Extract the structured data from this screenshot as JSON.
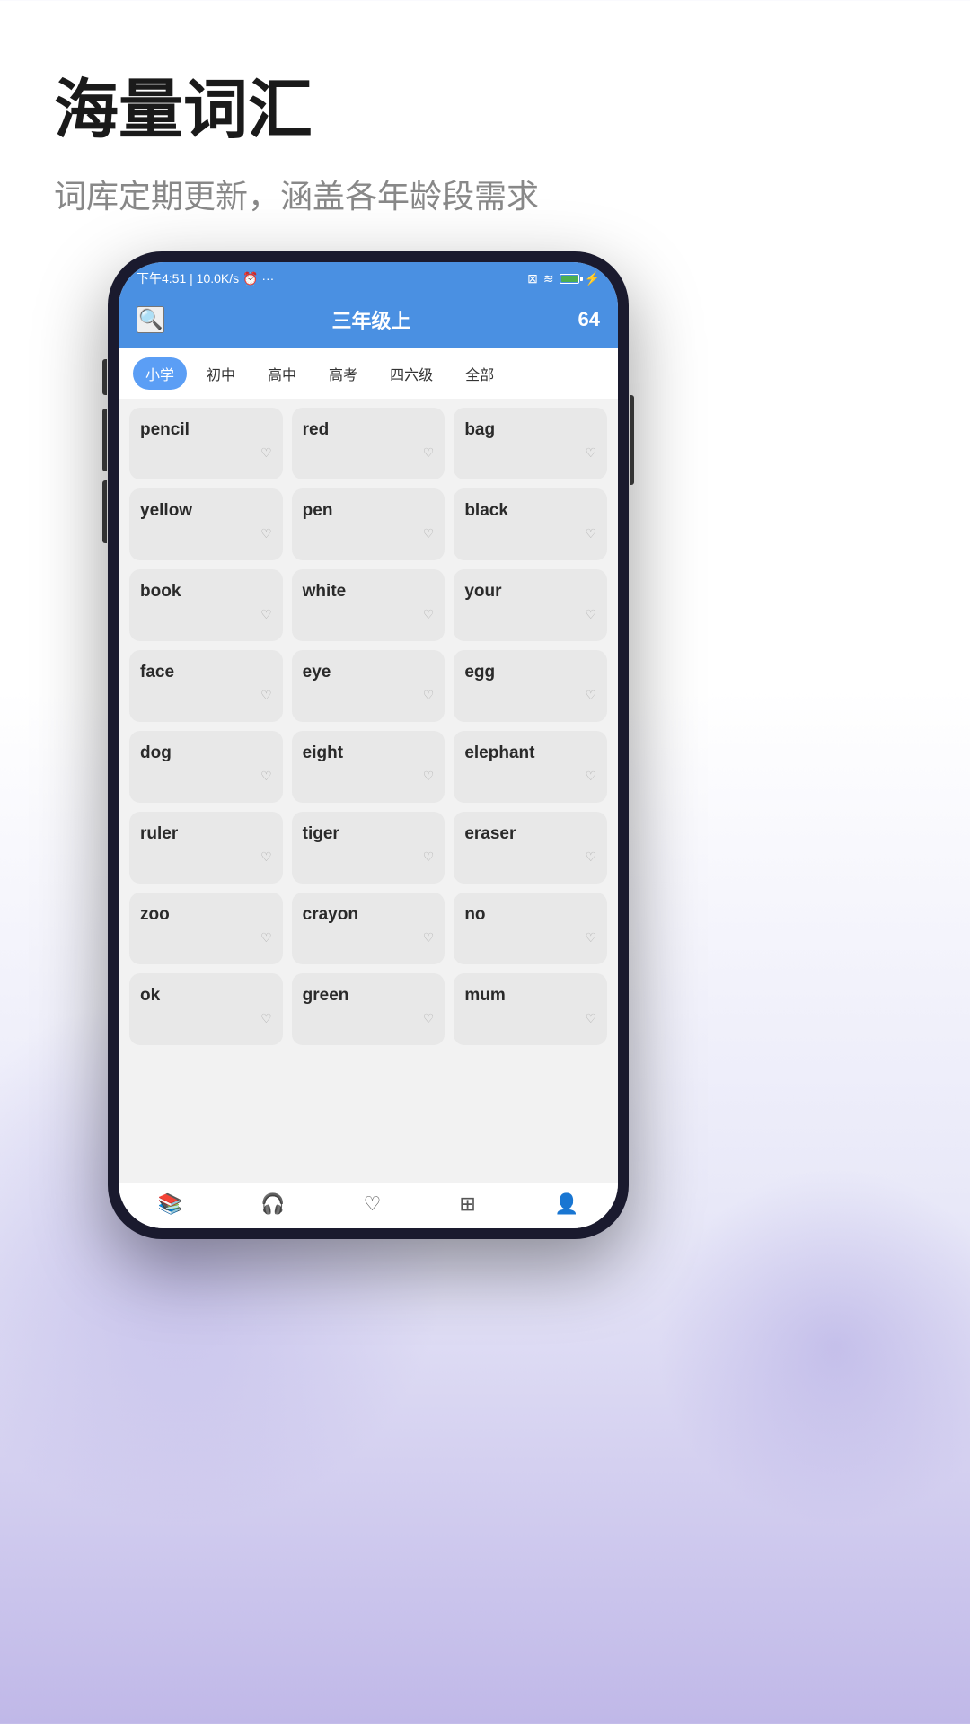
{
  "page": {
    "title": "海量词汇",
    "subtitle": "词库定期更新，涵盖各年龄段需求"
  },
  "status_bar": {
    "time": "下午4:51",
    "network": "10.0K/s",
    "icons": "⊠ ☁ 100"
  },
  "app_header": {
    "title": "三年级上",
    "word_count": "64"
  },
  "tabs": [
    {
      "label": "小学",
      "active": true
    },
    {
      "label": "初中",
      "active": false
    },
    {
      "label": "高中",
      "active": false
    },
    {
      "label": "高考",
      "active": false
    },
    {
      "label": "四六级",
      "active": false
    },
    {
      "label": "全部",
      "active": false
    }
  ],
  "words": [
    "pencil",
    "red",
    "bag",
    "yellow",
    "pen",
    "black",
    "book",
    "white",
    "your",
    "face",
    "eye",
    "egg",
    "dog",
    "eight",
    "elephant",
    "ruler",
    "tiger",
    "eraser",
    "zoo",
    "crayon",
    "no",
    "ok",
    "green",
    "mum"
  ],
  "bottom_nav": [
    {
      "icon": "📋",
      "label": "词库",
      "active": true
    },
    {
      "icon": "🎧",
      "label": "听写",
      "active": false
    },
    {
      "icon": "♡",
      "label": "收藏",
      "active": false
    },
    {
      "icon": "🔲",
      "label": "拓展",
      "active": false
    },
    {
      "icon": "👤",
      "label": "我的",
      "active": false
    }
  ]
}
